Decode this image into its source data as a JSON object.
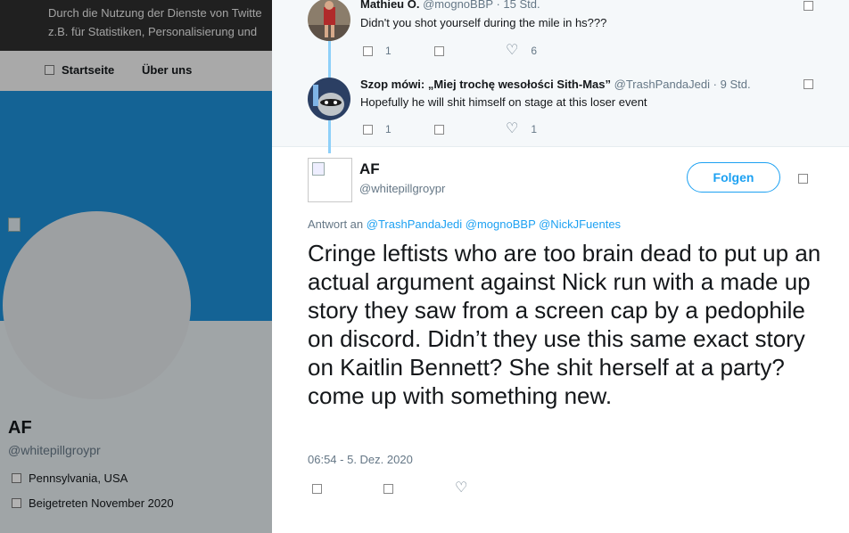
{
  "cookie_notice": {
    "line1": "Durch die Nutzung der Dienste von Twitte",
    "line2": "z.B. für Statistiken, Personalisierung und"
  },
  "nav": {
    "home": "Startseite",
    "about": "Über uns"
  },
  "profile": {
    "name": "AF",
    "handle": "@whitepillgroypr",
    "location": "Pennsylvania, USA",
    "joined": "Beigetreten November 2020"
  },
  "replies": [
    {
      "name": "Mathieu O.",
      "handle": "@mognoBBP",
      "time": "15 Std.",
      "text": "Didn't you shot yourself during the mile in hs???",
      "replies": "1",
      "likes": "6"
    },
    {
      "name": "Szop mówi: „Miej trochę wesołości Sith-Mas”",
      "handle": "@TrashPandaJedi",
      "time": "9 Std.",
      "text": "Hopefully he will shit himself on stage at this loser event",
      "replies": "1",
      "likes": "1"
    }
  ],
  "tweet": {
    "name": "AF",
    "handle": "@whitepillgroypr",
    "follow_label": "Folgen",
    "reply_prefix": "Antwort an",
    "reply_to": "@TrashPandaJedi @mognoBBP @NickJFuentes",
    "text": "Cringe leftists who are too brain dead to put up an actual argument against Nick run with a made up story they saw from a screen cap by a pedophile on discord. Didn’t they use this same exact story on Kaitlin Bennett? She shit herself at a party? come up with something new.",
    "timestamp": "06:54 - 5. Dez. 2020"
  },
  "colors": {
    "accent": "#1da1f2",
    "banner": "#1d8ed6",
    "thread_line": "#8ed0f9"
  }
}
